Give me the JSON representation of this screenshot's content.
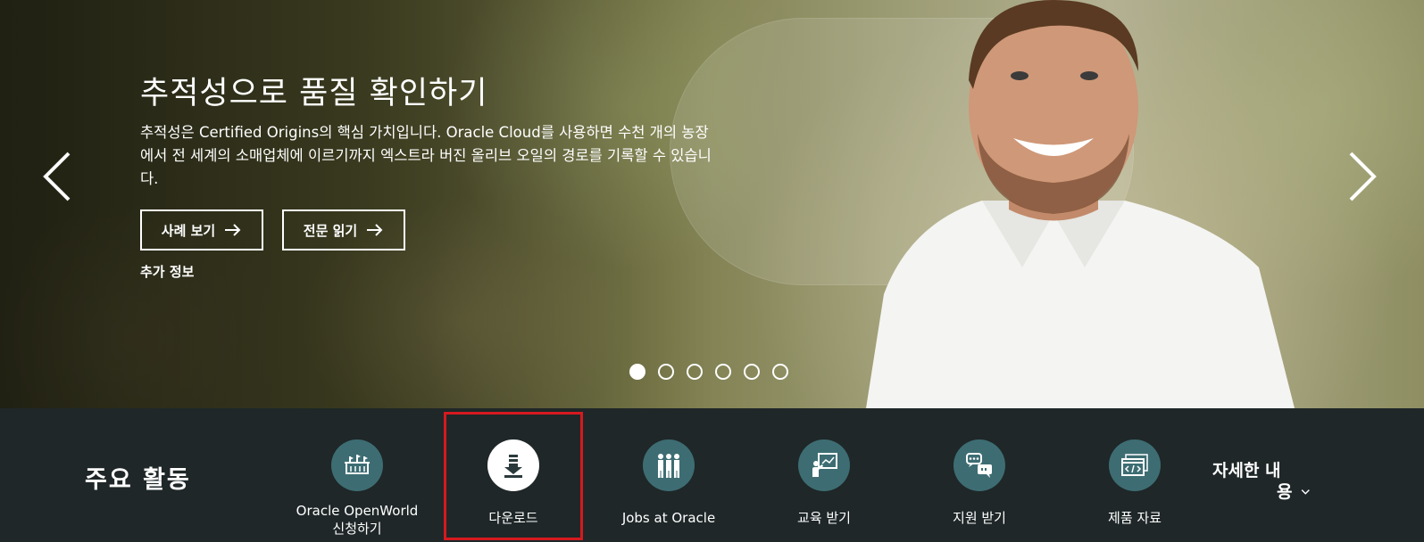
{
  "hero": {
    "title": "추적성으로 품질 확인하기",
    "description": "추적성은 Certified Origins의 핵심 가치입니다. Oracle Cloud를 사용하면 수천 개의 농장에서 전 세계의 소매업체에 이르기까지 엑스트라 버진 올리브 오일의 경로를 기록할 수 있습니다.",
    "buttons": [
      {
        "label": "사례 보기",
        "icon": "arrow-right-icon"
      },
      {
        "label": "전문 읽기",
        "icon": "arrow-right-icon"
      }
    ],
    "more_link": "추가 정보",
    "prev_icon": "chevron-left-icon",
    "next_icon": "chevron-right-icon",
    "slides_total": 6,
    "slide_active": 1
  },
  "activities": {
    "title": "주요 활동",
    "items": [
      {
        "label": "Oracle OpenWorld 신청하기",
        "icon": "conference-icon"
      },
      {
        "label": "다운로드",
        "icon": "download-icon"
      },
      {
        "label": "Jobs at Oracle",
        "icon": "people-icon"
      },
      {
        "label": "교육 받기",
        "icon": "presentation-icon"
      },
      {
        "label": "지원 받기",
        "icon": "chat-support-icon"
      },
      {
        "label": "제품 자료",
        "icon": "code-window-icon"
      }
    ],
    "more_label_line1": "자세한 내",
    "more_label_line2": "용",
    "more_icon": "chevron-down-icon",
    "highlight_color": "#d71920"
  }
}
